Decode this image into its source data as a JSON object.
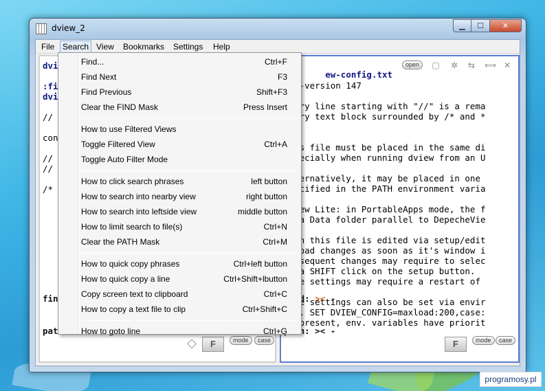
{
  "window": {
    "title": "dview_2"
  },
  "menubar": [
    "File",
    "Search",
    "View",
    "Bookmarks",
    "Settings",
    "Help"
  ],
  "search_menu": {
    "groups": [
      [
        {
          "label": "Find...",
          "shortcut": "Ctrl+F"
        },
        {
          "label": "Find Next",
          "shortcut": "F3"
        },
        {
          "label": "Find Previous",
          "shortcut": "Shift+F3"
        },
        {
          "label": "Clear the FIND Mask",
          "shortcut": "Press Insert"
        }
      ],
      [
        {
          "label": "How to use Filtered Views",
          "shortcut": ""
        },
        {
          "label": "Toggle Filtered View",
          "shortcut": "Ctrl+A"
        },
        {
          "label": "Toggle Auto Filter Mode",
          "shortcut": ""
        }
      ],
      [
        {
          "label": "How to click search phrases",
          "shortcut": "left button"
        },
        {
          "label": "How to search into nearby view",
          "shortcut": "right button"
        },
        {
          "label": "How to search into leftside view",
          "shortcut": "middle button"
        },
        {
          "label": "How to limit search to file(s)",
          "shortcut": "Ctrl+N"
        },
        {
          "label": "Clear the PATH Mask",
          "shortcut": "Ctrl+M"
        }
      ],
      [
        {
          "label": "How to quick copy phrases",
          "shortcut": "Ctrl+left button"
        },
        {
          "label": "How to quick copy a line",
          "shortcut": "Ctrl+Shift+lbutton"
        },
        {
          "label": "Copy screen text to clipboard",
          "shortcut": "Ctrl+C"
        },
        {
          "label": "How to copy a text file to clip",
          "shortcut": "Ctrl+Shift+C"
        }
      ],
      [
        {
          "label": "How to goto line",
          "shortcut": "Ctrl+G"
        }
      ]
    ]
  },
  "left_pane": {
    "lines": [
      {
        "text": "dvi",
        "style": "blue"
      },
      {
        "text": "",
        "style": ""
      },
      {
        "text": ":fi",
        "style": "blue"
      },
      {
        "text": "dvi",
        "style": "blue"
      },
      {
        "text": "",
        "style": ""
      },
      {
        "text": "//",
        "style": ""
      },
      {
        "text": "",
        "style": ""
      },
      {
        "text": "con",
        "style": ""
      },
      {
        "text": "",
        "style": ""
      },
      {
        "text": "//",
        "style": ""
      },
      {
        "text": "//",
        "style": ""
      },
      {
        "text": "",
        "style": ""
      },
      {
        "text": "/*",
        "style": ""
      }
    ],
    "find_label": "find:",
    "path_label": "path:",
    "find_value": "-",
    "path_value": "-",
    "mode_label": "mode",
    "case_label": "case",
    "f_label": "F"
  },
  "right_pane": {
    "header_file": "ew-config.txt",
    "open_label": "open",
    "lines": [
      "fig-version 147",
      "",
      "Every line starting with \"//\" is a rema",
      "Every text block surrounded by /* and *",
      "",
      "",
      "This file must be placed in the same di",
      "especially when running dview from an U",
      "",
      "Alternatively, it may be placed in one",
      "specified in the PATH environment varia",
      "",
      "DView Lite: in PortableApps mode, the f",
      "in a Data folder parallel to DepecheVie",
      "",
      "When this file is edited via setup/edit",
      "reload changes as soon as it's window i",
      "Subsequent changes may require to selec",
      "or a SHIFT click on the setup button.",
      "Some settings may require a restart of",
      "",
      "Some settings can also be set via envir",
      "e.g. SET DVIEW_CONFIG=maxload:200,case:",
      "If present, env. variables have priorit"
    ],
    "find_label": "find:",
    "path_label": "path:",
    "find_value": "-",
    "path_value": "-",
    "mode_label": "mode",
    "case_label": "case",
    "f_label": "F"
  },
  "watermark": "programosy.pl"
}
